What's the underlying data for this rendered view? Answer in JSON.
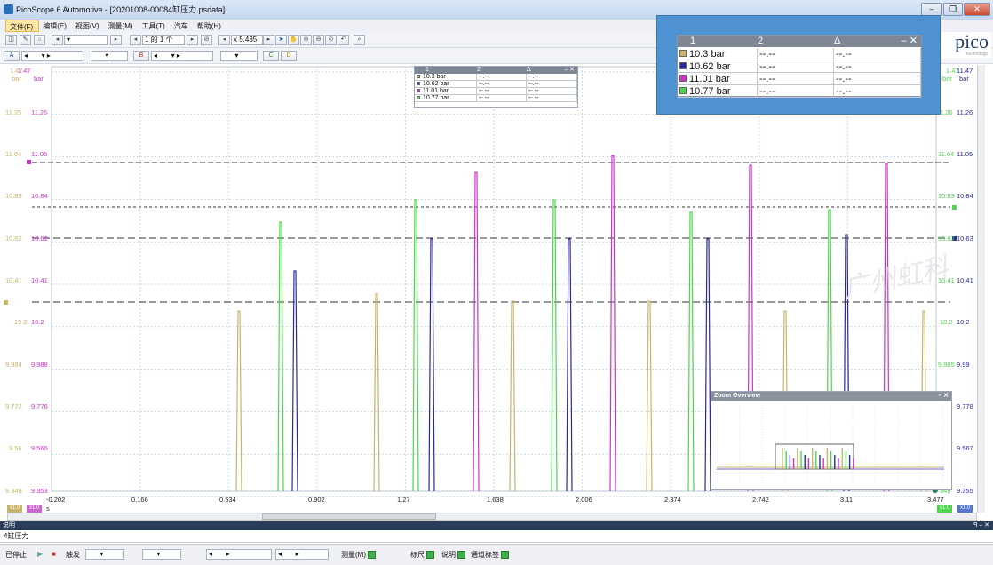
{
  "window": {
    "title": "PicoScope 6 Automotive - [20201008-00084缸压力.psdata]",
    "buttons": {
      "minimize": "–",
      "restore": "❐",
      "close": "✕"
    }
  },
  "menu": [
    "文件(F)",
    "编辑(E)",
    "视图(V)",
    "测量(M)",
    "工具(T)",
    "汽车",
    "帮助(H)"
  ],
  "toolbar1": {
    "capture_count": "1 的 1 个",
    "zoom": "x 5.435"
  },
  "toolbar2": {
    "channel_a": "A",
    "channel_b": "B",
    "channel_c": "C",
    "channel_d": "D"
  },
  "axes": {
    "left_a_labels": [
      "1.47",
      "11.25",
      "11.04",
      "10.83",
      "10.62",
      "10.41",
      "10.2",
      "9.984",
      "9.772",
      "9.56",
      "9.348"
    ],
    "left_b_labels": [
      "1.47",
      "11.26",
      "11.05",
      "10.84",
      "10.62",
      "10.41",
      "10.2",
      "9.988",
      "9.776",
      "9.565",
      "9.353"
    ],
    "right_c_labels": [
      "1.47",
      "1.26",
      "11.04",
      "10.83",
      "10.62",
      "10.41",
      "10.2",
      "9.985",
      "",
      "",
      "349"
    ],
    "right_d_labels": [
      "11.47",
      "11.26",
      "11.05",
      "10.84",
      "10.63",
      "10.41",
      "10.2",
      "9.99",
      "9.778",
      "9.567",
      "9.355"
    ],
    "unit": "bar",
    "x_labels": [
      "-0.202",
      "0.166",
      "0.534",
      "0.902",
      "1.27",
      "1.638",
      "2.006",
      "2.374",
      "2.742",
      "3.11",
      "3.477"
    ],
    "x_unit": "s",
    "scale_tags": [
      "x1.0",
      "x1.0",
      "x1.0",
      "x1.0"
    ]
  },
  "colors": {
    "a": "#c8b46a",
    "b": "#cc33cc",
    "c": "#4cd64c",
    "d": "#2a2a99"
  },
  "legend": {
    "headers": [
      "1",
      "2",
      "Δ"
    ],
    "rows": [
      {
        "value": "10.3 bar",
        "c2": "--.--",
        "c3": "--.--",
        "color": "#c8b46a"
      },
      {
        "value": "10.62 bar",
        "c2": "--.--",
        "c3": "--.--",
        "color": "#2a2a99"
      },
      {
        "value": "11.01 bar",
        "c2": "--.--",
        "c3": "--.--",
        "color": "#cc33cc"
      },
      {
        "value": "10.77 bar",
        "c2": "--.--",
        "c3": "--.--",
        "color": "#4cd64c"
      }
    ]
  },
  "logo": {
    "text": "pico",
    "sub": "Technology"
  },
  "watermark": "广州虹科",
  "zoom_overview": {
    "title": "Zoom Overview"
  },
  "notes": {
    "header": "说明",
    "text": "4缸压力"
  },
  "status": {
    "stop": "已停止",
    "trigger": "触发",
    "measure": "测量(M)",
    "ruler": "标尺",
    "notes": "说明",
    "channel_labels": "通道标签"
  }
}
